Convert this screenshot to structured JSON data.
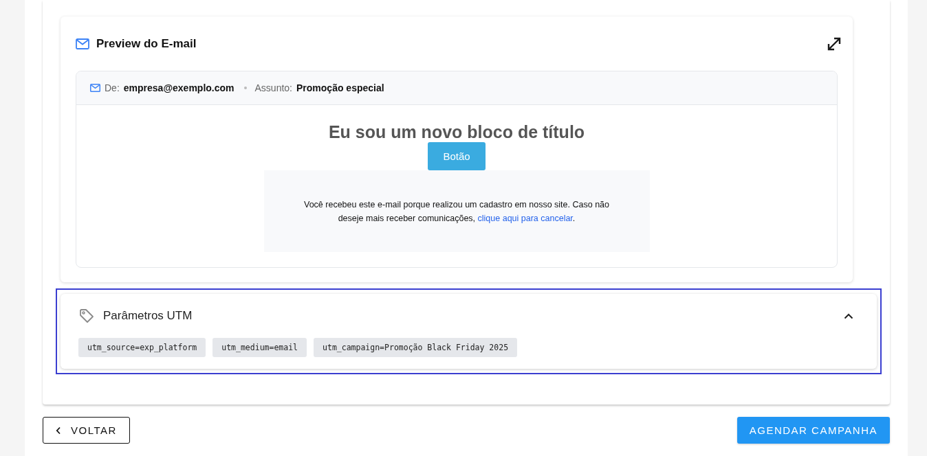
{
  "preview": {
    "title": "Preview do E-mail",
    "from_label": "De:",
    "from": "empresa@exemplo.com",
    "subject_label": "Assunto:",
    "subject": "Promoção especial",
    "heading": "Eu sou um novo bloco de título",
    "button": "Botão",
    "footer_text": "Você recebeu este e-mail porque realizou um cadastro em nosso site. Caso não deseje mais receber comunicações, ",
    "footer_link": "clique aqui para cancelar",
    "footer_end": "."
  },
  "utm": {
    "title": "Parâmetros UTM",
    "expanded": true,
    "focused": true,
    "params": [
      "utm_source=exp_platform",
      "utm_medium=email",
      "utm_campaign=Promoção Black Friday 2025"
    ]
  },
  "actions": {
    "back": "VOLTAR",
    "submit": "AGENDAR CAMPANHA"
  }
}
